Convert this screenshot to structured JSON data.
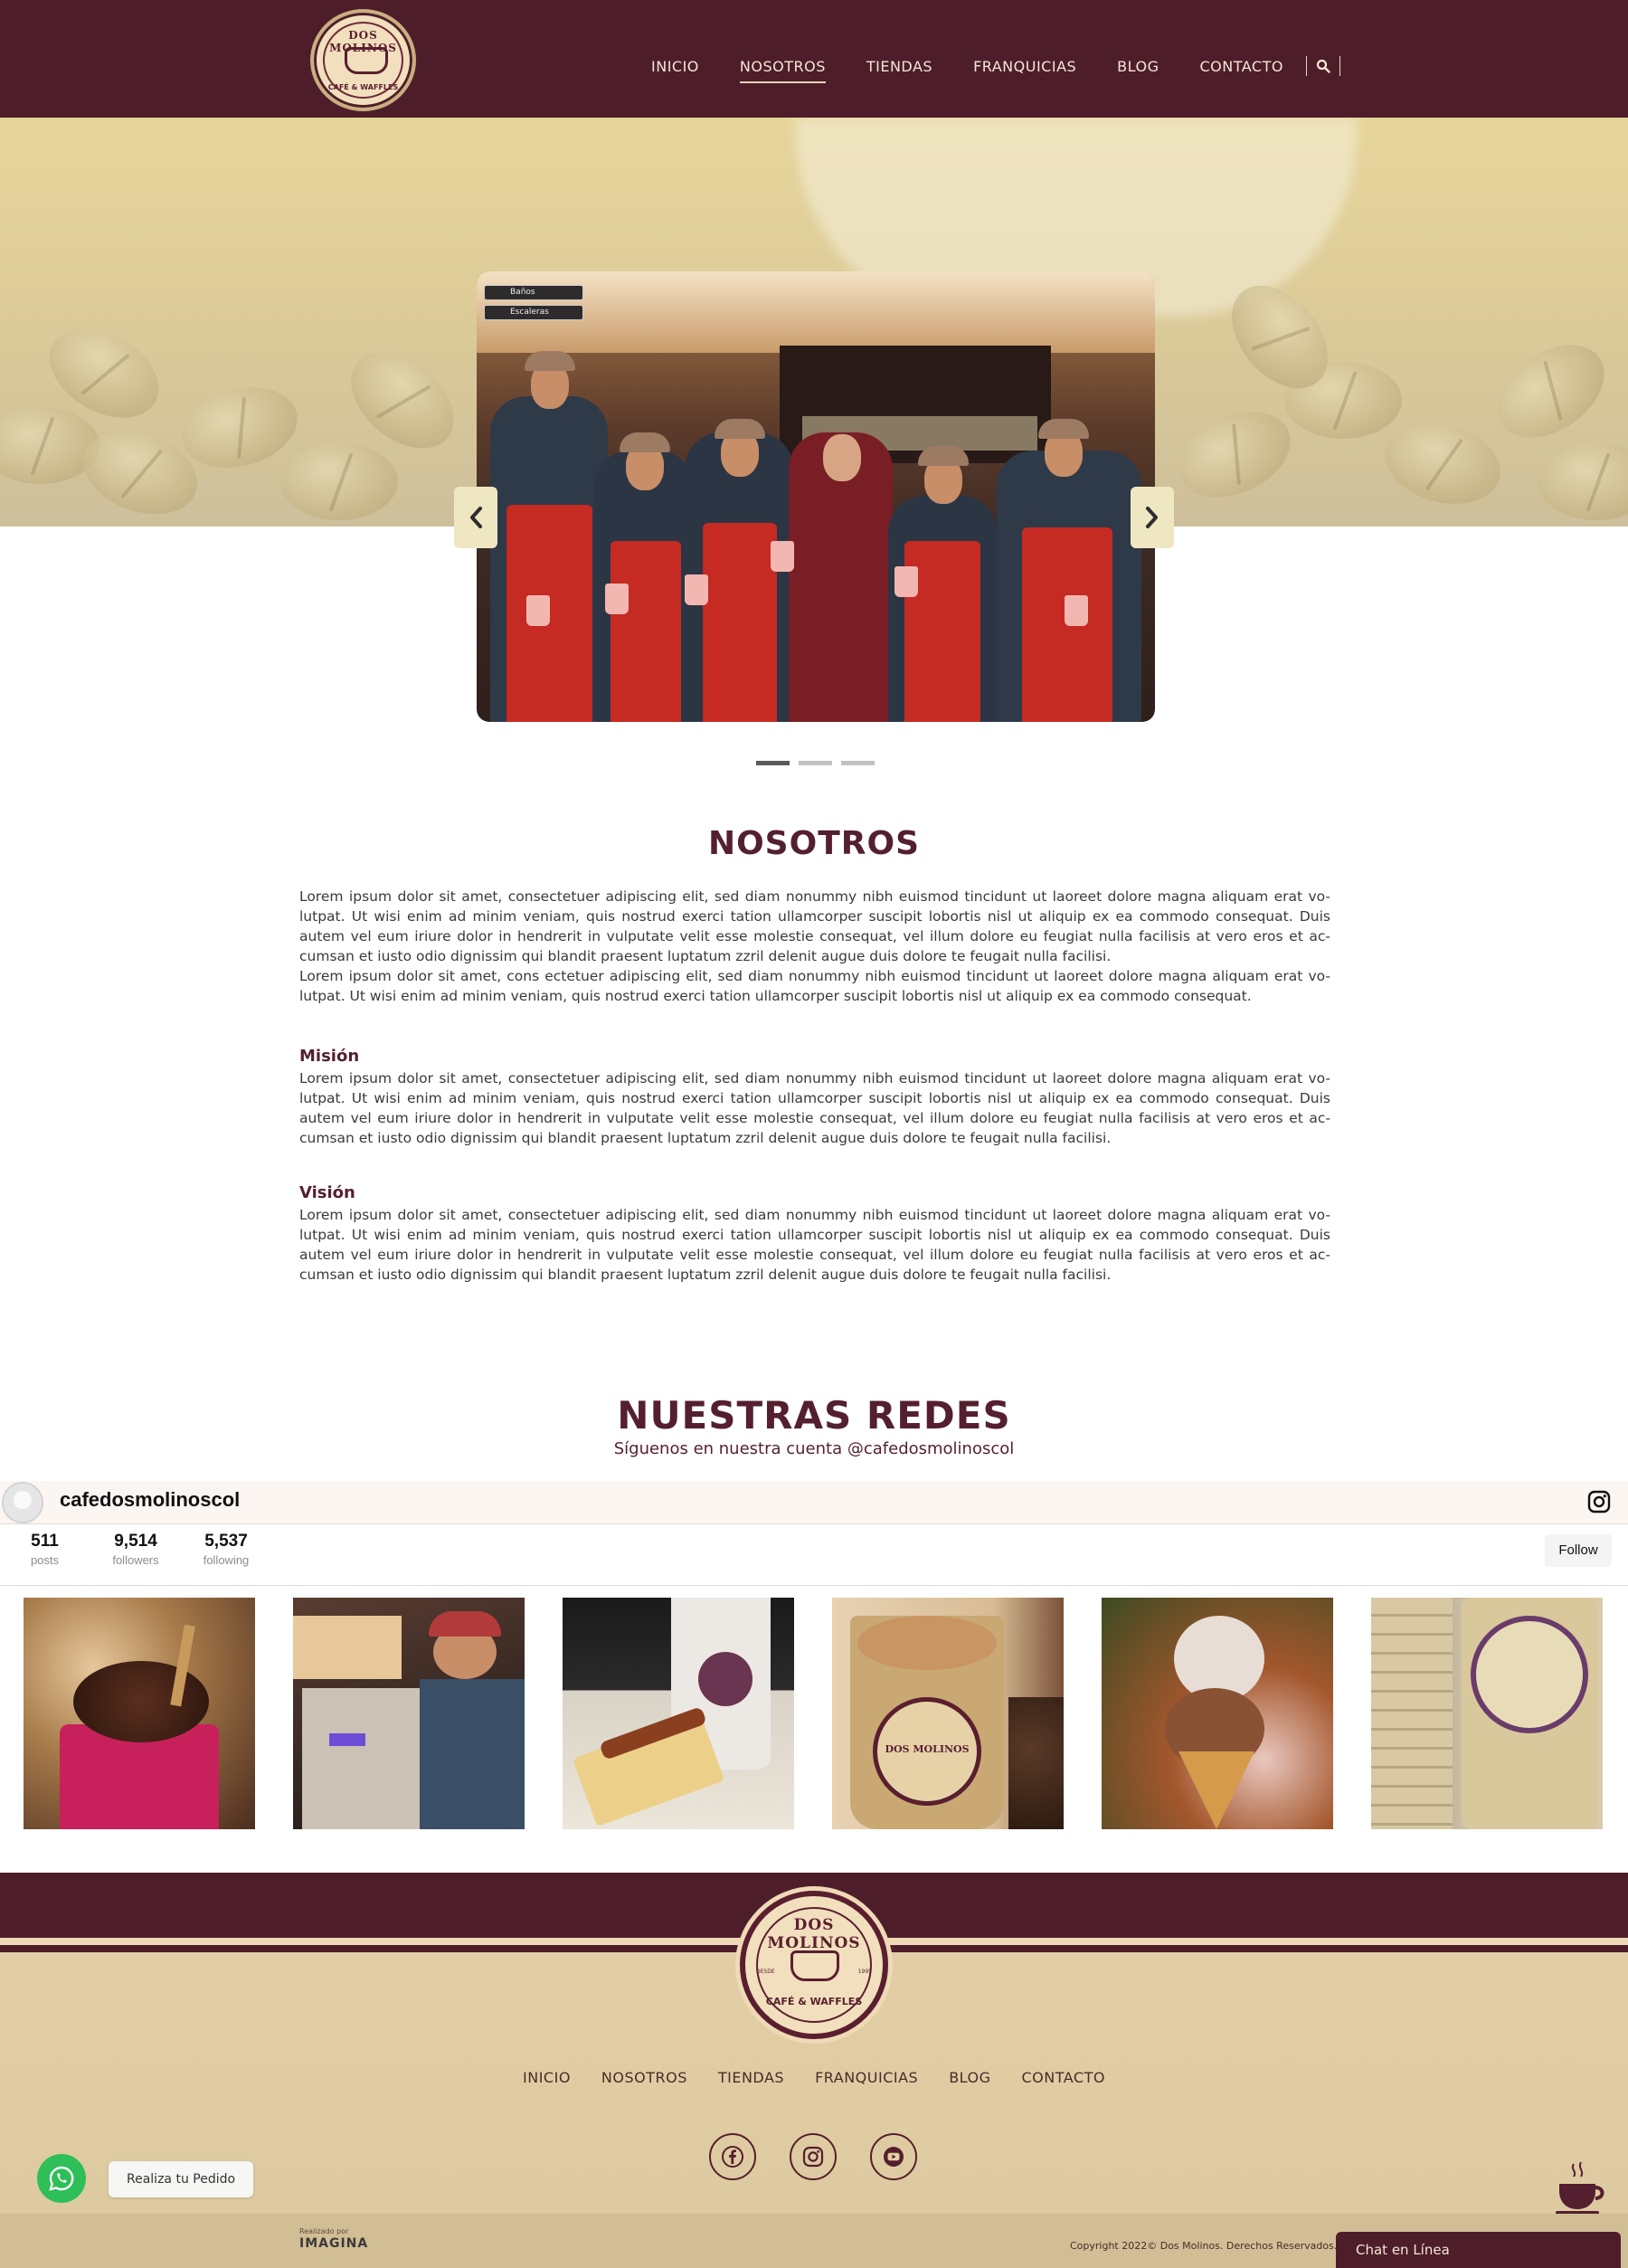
{
  "header": {
    "logo_top": "DOS MOLINOS",
    "logo_bottom": "CAFÉ & WAFFLES",
    "nav": [
      "INICIO",
      "NOSOTROS",
      "TIENDAS",
      "FRANQUICIAS",
      "BLOG",
      "CONTACTO"
    ],
    "active_nav": "NOSOTROS"
  },
  "slider": {
    "sign_1": "Baños",
    "sign_2": "Escaleras",
    "slide_count": 3,
    "active_slide": 1
  },
  "about": {
    "title": "NOSOTROS",
    "p1": "Lorem ipsum dolor sit amet, consectetuer adipiscing elit, sed diam nonummy nibh euismod tincidunt ut laoreet dolore magna aliquam erat vo-lutpat. Ut wisi enim ad minim veniam, quis nostrud exerci tation ullamcorper suscipit lobortis nisl ut aliquip ex ea commodo consequat. Duis autem vel eum iriure dolor in hendrerit in vulputate velit esse molestie consequat, vel illum dolore eu feugiat nulla facilisis at vero eros et ac-cumsan et iusto odio dignissim qui blandit praesent luptatum zzril delenit augue duis dolore te feugait nulla facilisi.",
    "p2": "Lorem ipsum dolor sit amet, cons ectetuer adipiscing elit, sed diam nonummy nibh euismod tincidunt ut laoreet dolore magna aliquam erat vo-lutpat. Ut wisi enim ad minim veniam, quis nostrud exerci tation ullamcorper suscipit lobortis nisl ut aliquip ex ea commodo consequat.",
    "mission_title": "Misión",
    "mission_text": "Lorem ipsum dolor sit amet, consectetuer adipiscing elit, sed diam nonummy nibh euismod tincidunt ut laoreet dolore magna aliquam erat vo-lutpat. Ut wisi enim ad minim veniam, quis nostrud exerci tation ullamcorper suscipit lobortis nisl ut aliquip ex ea commodo consequat. Duis autem vel eum iriure dolor in hendrerit in vulputate velit esse molestie consequat, vel illum dolore eu feugiat nulla facilisis at vero eros et ac-cumsan et iusto odio dignissim qui blandit praesent luptatum zzril delenit augue duis dolore te feugait nulla facilisi.",
    "vision_title": "Visión",
    "vision_text": "Lorem ipsum dolor sit amet, consectetuer adipiscing elit, sed diam nonummy nibh euismod tincidunt ut laoreet dolore magna aliquam erat vo-lutpat. Ut wisi enim ad minim veniam, quis nostrud exerci tation ullamcorper suscipit lobortis nisl ut aliquip ex ea commodo consequat. Duis autem vel eum iriure dolor in hendrerit in vulputate velit esse molestie consequat, vel illum dolore eu feugiat nulla facilisis at vero eros et ac-cumsan et iusto odio dignissim qui blandit praesent luptatum zzril delenit augue duis dolore te feugait nulla facilisi."
  },
  "social": {
    "title": "NUESTRAS REDES",
    "subtitle": "Síguenos en nuestra cuenta @cafedosmolinoscol",
    "username": "cafedosmolinoscol",
    "stats": [
      {
        "value": "511",
        "label": "posts"
      },
      {
        "value": "9,514",
        "label": "followers"
      },
      {
        "value": "5,537",
        "label": "following"
      }
    ],
    "follow_label": "Follow",
    "tile_cup_text": "DOS MOLINOS"
  },
  "footer": {
    "logo_top": "DOS MOLINOS",
    "logo_bottom": "CAFÉ & WAFFLES",
    "logo_desde": "DESDE",
    "logo_year": "1995",
    "nav": [
      "INICIO",
      "NOSOTROS",
      "TIENDAS",
      "FRANQUICIAS",
      "BLOG",
      "CONTACTO"
    ],
    "whatsapp_label": "Realiza tu Pedido",
    "credit_small": "Realizado por",
    "credit_brand": "IMAGINA",
    "copyright": "Copyright 2022© Dos Molinos. Derechos Reservados.",
    "chat_label": "Chat en Línea"
  },
  "colors": {
    "brand": "#4e1d2a",
    "cream": "#e4d0a6",
    "whatsapp": "#2fbf59"
  },
  "icons": [
    "search-icon",
    "chevron-left-icon",
    "chevron-right-icon",
    "instagram-icon",
    "facebook-icon",
    "youtube-icon",
    "whatsapp-icon",
    "coffee-cup-icon"
  ]
}
